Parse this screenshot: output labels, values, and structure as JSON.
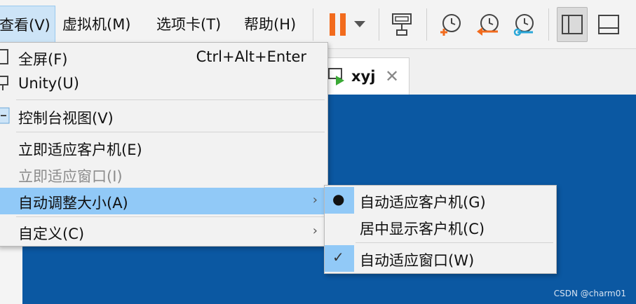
{
  "menubar": {
    "items": [
      {
        "label": "查看(V)",
        "active": true
      },
      {
        "label": "虚拟机(M)"
      },
      {
        "label": "选项卡(T)"
      },
      {
        "label": "帮助(H)"
      }
    ]
  },
  "toolbar": {
    "icons": [
      "pause-icon",
      "dropdown-arrow-icon",
      "send-ctrl-alt-del-icon",
      "snapshot-take-icon",
      "snapshot-revert-icon",
      "snapshot-manager-icon",
      "library-panel-icon",
      "thumbnail-bar-icon"
    ],
    "colors": {
      "pause": "#f26b1d",
      "snapshot_arrow": "#f26b1d",
      "snapshot_wrench": "#2aa7d8"
    }
  },
  "tab": {
    "label": "xyj",
    "close": "✕"
  },
  "view_menu": {
    "items": [
      {
        "label": "全屏(F)",
        "shortcut": "Ctrl+Alt+Enter"
      },
      {
        "label": "Unity(U)"
      },
      {
        "label": "控制台视图(V)"
      },
      {
        "label": "立即适应客户机(E)"
      },
      {
        "label": "立即适应窗口(I)",
        "disabled": true
      },
      {
        "label": "自动调整大小(A)",
        "highlighted": true,
        "submenu": true
      },
      {
        "label": "自定义(C)",
        "submenu": true
      }
    ],
    "arrow": "›"
  },
  "autosize_submenu": {
    "items": [
      {
        "label": "自动适应客户机(G)",
        "mark": "●"
      },
      {
        "label": "居中显示客户机(C)"
      },
      {
        "label": "自动适应窗口(W)",
        "mark": "✓"
      }
    ]
  },
  "watermark": "CSDN @charm01",
  "colors": {
    "console_bg": "#0b58a2",
    "highlight": "#91c9f7"
  }
}
